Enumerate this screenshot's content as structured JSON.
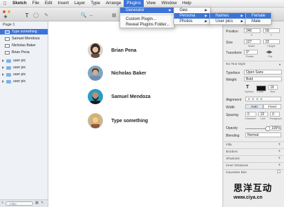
{
  "menubar": {
    "app": "Sketch",
    "items": [
      "File",
      "Edit",
      "Insert",
      "Layer",
      "Type",
      "Arrange",
      "Plugins",
      "View",
      "Window",
      "Help"
    ]
  },
  "plugins_menu": {
    "items": [
      "Generator",
      "Custom Plugin...",
      "Reveal Plugins Folder..."
    ]
  },
  "generator_menu": {
    "items": [
      "Geo",
      "Persona",
      "Photos"
    ]
  },
  "persona_menu": {
    "items": [
      "Names",
      "User pics"
    ]
  },
  "names_menu": {
    "items": [
      "Female",
      "Male"
    ]
  },
  "sidebar": {
    "page": "Page 1",
    "layers": [
      {
        "label": "Type something",
        "selected": true
      },
      {
        "label": "Samuel Mendoza"
      },
      {
        "label": "Nicholas Baker"
      },
      {
        "label": "Brian Pena"
      },
      {
        "label": "user pic",
        "group": true
      },
      {
        "label": "user pic",
        "group": true
      },
      {
        "label": "user pic",
        "group": true
      },
      {
        "label": "user pic",
        "group": true
      }
    ],
    "filter_placeholder": "Filter"
  },
  "canvas": {
    "rows": [
      {
        "name": "Brian Pena",
        "avatar": "woman-avatar"
      },
      {
        "name": "Nicholas Baker",
        "avatar": "man-avatar"
      },
      {
        "name": "Samuel Mendoza",
        "avatar": "bearded-man-avatar"
      },
      {
        "name": "Type something",
        "avatar": "woman-blonde-avatar"
      }
    ]
  },
  "inspector": {
    "position_label": "Position",
    "position": {
      "x": "240",
      "y": "59",
      "x_label": "X",
      "y_label": "Y"
    },
    "size_label": "Size",
    "size": {
      "w": "127",
      "h": "22",
      "w_label": "Width",
      "h_label": "Height"
    },
    "transform_label": "Transform",
    "rotate": "0°",
    "rotate_label": "Rotate",
    "flip_label": "Flip",
    "text_style": "No Text Style",
    "typeface_label": "Typeface",
    "typeface": "Open Sans",
    "weight_label": "Weight",
    "weight": "Bold",
    "font_size": "16",
    "options_label": "Options",
    "color_label": "Color",
    "size_small_label": "Size",
    "alignment_label": "Alignment",
    "width_label": "Width",
    "width_auto": "Auto",
    "width_fixed": "Fixed",
    "spacing_label": "Spacing",
    "spacing": {
      "character": "0",
      "line": "22",
      "paragraph": "0"
    },
    "spacing_sub": {
      "character": "Character",
      "line": "Line",
      "paragraph": "Paragraph"
    },
    "opacity_label": "Opacity",
    "opacity": "100%",
    "opacity_value": 1.0,
    "blending_label": "Blending",
    "blending": "Normal",
    "sections": [
      "Fills",
      "Borders",
      "Shadows",
      "Inner Shadows",
      "Gaussian Blur"
    ]
  },
  "watermark": {
    "title": "思洋互动",
    "url": "www.ciya.cn"
  },
  "colors": {
    "accent": "#3d74d8"
  }
}
